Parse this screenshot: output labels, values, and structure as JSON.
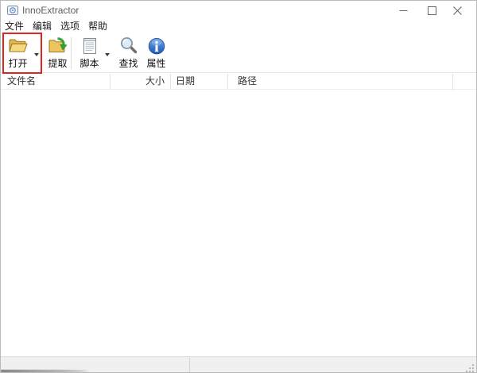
{
  "window": {
    "title": "InnoExtractor"
  },
  "menu": {
    "items": [
      {
        "label": "文件"
      },
      {
        "label": "编辑"
      },
      {
        "label": "选项"
      },
      {
        "label": "帮助"
      }
    ]
  },
  "toolbar": {
    "buttons": [
      {
        "label": "打开",
        "icon": "open-folder-icon",
        "dropdown": true
      },
      {
        "label": "提取",
        "icon": "extract-folder-icon",
        "dropdown": false
      },
      {
        "label": "脚本",
        "icon": "script-document-icon",
        "dropdown": true
      },
      {
        "label": "查找",
        "icon": "search-magnifier-icon",
        "dropdown": false
      },
      {
        "label": "属性",
        "icon": "info-icon",
        "dropdown": false
      }
    ],
    "annotation": {
      "highlighted_button": "打开",
      "color": "#e0261c"
    }
  },
  "file_list": {
    "columns": [
      {
        "label": "文件名",
        "align": "left"
      },
      {
        "label": "大小",
        "align": "right"
      },
      {
        "label": "日期",
        "align": "left"
      },
      {
        "label": "路径",
        "align": "left"
      }
    ],
    "rows": []
  },
  "status_bar": {
    "left_text": "",
    "right_text": ""
  },
  "colors": {
    "annotation_red": "#e0261c",
    "folder_gold": "#f2cd68",
    "folder_outline": "#9c7a20",
    "extract_green": "#36a336",
    "info_blue": "#2f6fce",
    "statusbar_bg": "#f0f0f0",
    "title_text": "#5d5d5d"
  }
}
